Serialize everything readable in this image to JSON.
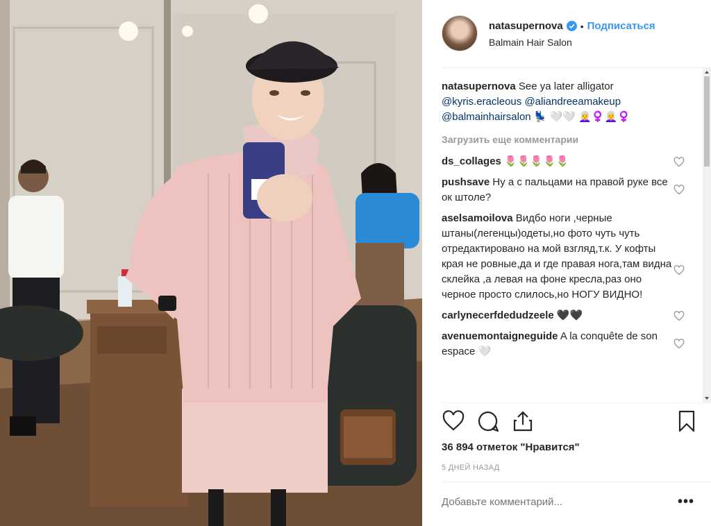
{
  "post": {
    "author": "natasupernova",
    "dot": "•",
    "follow_label": "Подписаться",
    "location": "Balmain Hair Salon"
  },
  "caption": {
    "user": "natasupernova",
    "text": "See ya later alligator",
    "mentions": [
      "@kyris.eracleous",
      "@aliandreeamakeup",
      "@balmainhairsalon"
    ],
    "emoji": "💺 🤍🤍 👩‍🦳♀️👩‍🦳♀️"
  },
  "load_more_label": "Загрузить еще комментарии",
  "comments": [
    {
      "user": "ds_collages",
      "text": "🌷🌷🌷🌷🌷"
    },
    {
      "user": "pushsave",
      "text": "Ну а с пальцами на правой руке все ок штоле?"
    },
    {
      "user": "aselsamoilova",
      "text": "Видбо ноги ,черные штаны(легенцы)одеты,но фото чуть чуть отредактировано на мой взгляд,т.к. У кофты края не ровные,да и где правая нога,там видна склейка ,а левая на фоне кресла,раз оно черное просто слилось,но НОГУ ВИДНО!"
    },
    {
      "user": "carlynecerfdedudzeele",
      "text": "🖤🖤"
    },
    {
      "user": "avenuemontaigneguide",
      "text": "A la conquête de son espace 🤍"
    }
  ],
  "likes_label": "36 894 отметок \"Нравится\"",
  "time_ago": "5 ДНЕЙ НАЗАД",
  "add_comment_placeholder": "Добавьте комментарий...",
  "more_options": "•••",
  "colors": {
    "link": "#3897f0",
    "mention": "#003569",
    "muted": "#999999",
    "verified": "#3897f0"
  }
}
